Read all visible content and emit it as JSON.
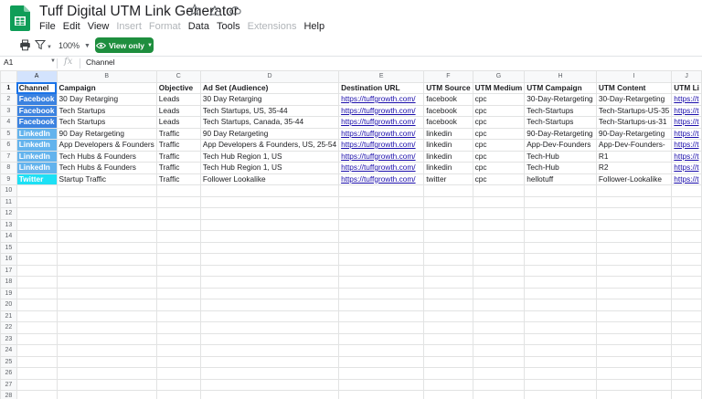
{
  "app": {
    "title": "Tuff Digital UTM Link Generator",
    "menus": [
      {
        "label": "File",
        "disabled": false
      },
      {
        "label": "Edit",
        "disabled": false
      },
      {
        "label": "View",
        "disabled": false
      },
      {
        "label": "Insert",
        "disabled": true
      },
      {
        "label": "Format",
        "disabled": true
      },
      {
        "label": "Data",
        "disabled": false
      },
      {
        "label": "Tools",
        "disabled": false
      },
      {
        "label": "Extensions",
        "disabled": true
      },
      {
        "label": "Help",
        "disabled": false
      }
    ]
  },
  "toolbar": {
    "zoom": "100%",
    "view_only_label": "View only",
    "icons": [
      "print-icon",
      "filter-icon",
      "eye-icon"
    ]
  },
  "formula_bar": {
    "cell_ref": "A1",
    "fx": "fx",
    "value": "Channel"
  },
  "colors": {
    "facebook": "#3b82e0",
    "linkedin": "#63b3ed",
    "twitter": "#1de0f5",
    "view_only_button": "#1e8e3e",
    "link": "#1a0dab"
  },
  "sheet": {
    "column_letters": [
      "A",
      "B",
      "C",
      "D",
      "E",
      "F",
      "G",
      "H",
      "I",
      "J"
    ],
    "header": [
      "Channel",
      "Campaign",
      "Objective",
      "Ad Set (Audience)",
      "Destination URL",
      "UTM Source",
      "UTM Medium",
      "UTM Campaign",
      "UTM Content",
      "UTM Li"
    ],
    "rows": [
      {
        "channel": "Facebook",
        "style": "facebook",
        "cells": [
          "30 Day Retarging",
          "Leads",
          "30 Day Retarging",
          "https://tuffgrowth.com/",
          "facebook",
          "cpc",
          "30-Day-Retargeting",
          "30-Day-Retargeting",
          "https://t"
        ]
      },
      {
        "channel": "Facebook",
        "style": "facebook",
        "cells": [
          "Tech Startups",
          "Leads",
          "Tech Startups, US, 35-44",
          "https://tuffgrowth.com/",
          "facebook",
          "cpc",
          "Tech-Startups",
          "Tech-Startups-US-35",
          "https://t"
        ]
      },
      {
        "channel": "Facebook",
        "style": "facebook",
        "cells": [
          "Tech Startups",
          "Leads",
          "Tech Startups, Canada, 35-44",
          "https://tuffgrowth.com/",
          "facebook",
          "cpc",
          "Tech-Startups",
          "Tech-Startups-us-31",
          "https://t"
        ]
      },
      {
        "channel": "LinkedIn",
        "style": "linkedin",
        "cells": [
          "90 Day Retargeting",
          "Traffic",
          "90 Day Retargeting",
          "https://tuffgrowth.com/",
          "linkedin",
          "cpc",
          "90-Day-Retargeting",
          "90-Day-Retargeting",
          "https://t"
        ]
      },
      {
        "channel": "LinkedIn",
        "style": "linkedin",
        "cells": [
          "App Developers & Founders",
          "Traffic",
          "App Developers & Founders, US, 25-54",
          "https://tuffgrowth.com/",
          "linkedin",
          "cpc",
          "App-Dev-Founders",
          "App-Dev-Founders-",
          "https://t"
        ]
      },
      {
        "channel": "LinkedIn",
        "style": "linkedin",
        "cells": [
          "Tech Hubs & Founders",
          "Traffic",
          "Tech Hub Region 1, US",
          "https://tuffgrowth.com/",
          "linkedin",
          "cpc",
          "Tech-Hub",
          "R1",
          "https://t"
        ]
      },
      {
        "channel": "LinkedIn",
        "style": "linkedin",
        "cells": [
          "Tech Hubs & Founders",
          "Traffic",
          "Tech Hub Region 1, US",
          "https://tuffgrowth.com/",
          "linkedin",
          "cpc",
          "Tech-Hub",
          "R2",
          "https://t"
        ]
      },
      {
        "channel": "Twitter",
        "style": "twitter",
        "cells": [
          "Startup Traffic",
          "Traffic",
          "Follower Lookalike",
          "https://tuffgrowth.com/",
          "twitter",
          "cpc",
          "hellotuff",
          "Follower-Lookalike",
          "https://t"
        ]
      }
    ],
    "empty_row_numbers": [
      "10",
      "11",
      "12",
      "13",
      "14",
      "15",
      "16",
      "17",
      "18",
      "19",
      "20",
      "21",
      "22",
      "23",
      "24",
      "25",
      "26",
      "27",
      "28"
    ]
  }
}
